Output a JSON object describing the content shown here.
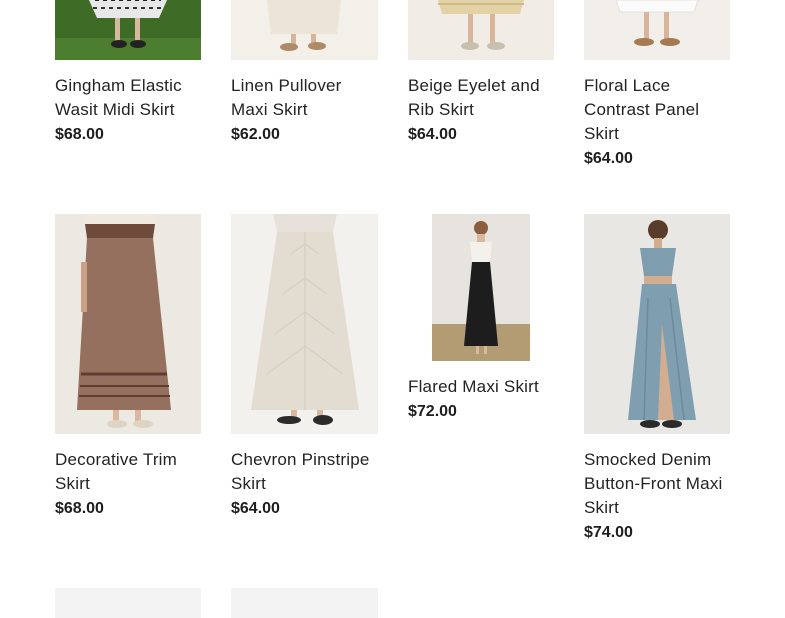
{
  "products": [
    {
      "title": "Gingham Elastic Wasit Midi Skirt",
      "price": "$68.00",
      "image": "gingham-skirt-photo"
    },
    {
      "title": "Linen Pullover Maxi Skirt",
      "price": "$62.00",
      "image": "linen-skirt-photo"
    },
    {
      "title": "Beige Eyelet and Rib Skirt",
      "price": "$64.00",
      "image": "eyelet-skirt-photo"
    },
    {
      "title": "Floral Lace Contrast Panel Skirt",
      "price": "$64.00",
      "image": "lace-skirt-photo"
    },
    {
      "title": "Decorative Trim Skirt",
      "price": "$68.00",
      "image": "trim-skirt-photo"
    },
    {
      "title": "Chevron Pinstripe Skirt",
      "price": "$64.00",
      "image": "chevron-skirt-photo"
    },
    {
      "title": "Flared Maxi Skirt",
      "price": "$72.00",
      "image": "flared-skirt-photo"
    },
    {
      "title": "Smocked Denim Button-Front Maxi Skirt",
      "price": "$74.00",
      "image": "denim-skirt-photo"
    }
  ],
  "colors": {
    "text": "#232323",
    "placeholder": "#f3f3f3"
  }
}
